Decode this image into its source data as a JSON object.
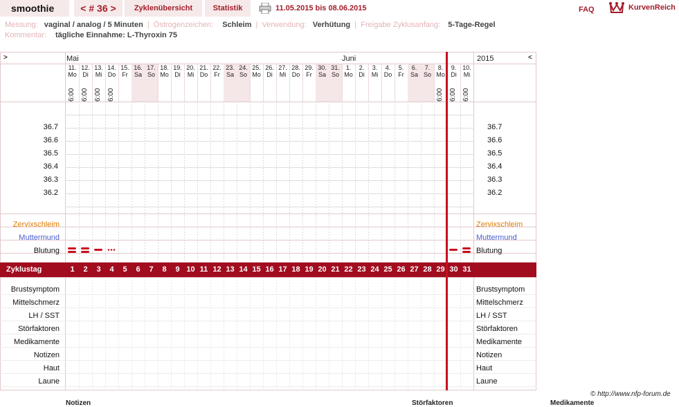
{
  "header": {
    "user": "smoothie",
    "cycle_nav": "< # 36 >",
    "tab_overview": "Zyklenübersicht",
    "tab_stats": "Statistik",
    "date_range": "11.05.2015 bis 08.06.2015",
    "faq": "FAQ",
    "logo_text": "KurvenReich"
  },
  "meta": {
    "messung_k": "Messung:",
    "messung_v": "vaginal / analog / 5 Minuten",
    "oestrogen_k": "Östrogenzeichen:",
    "oestrogen_v": "Schleim",
    "verwendung_k": "Verwendung:",
    "verwendung_v": "Verhütung",
    "freigabe_k": "Freigabe Zyklusanfang:",
    "freigabe_v": "5-Tage-Regel",
    "kommentar_k": "Kommentar:",
    "kommentar_v": "tägliche Einnahme: L-Thyroxin 75"
  },
  "chart": {
    "nav_left": ">",
    "nav_right": "<",
    "month_1": "Mai",
    "month_2": "Juni",
    "year": "2015",
    "days": [
      {
        "d": "11.",
        "w": "Mo",
        "t": "6:00",
        "we": false
      },
      {
        "d": "12.",
        "w": "Di",
        "t": "6:00",
        "we": false
      },
      {
        "d": "13.",
        "w": "Mi",
        "t": "6:00",
        "we": false
      },
      {
        "d": "14.",
        "w": "Do",
        "t": "6:00",
        "we": false
      },
      {
        "d": "15.",
        "w": "Fr",
        "t": "",
        "we": false
      },
      {
        "d": "16.",
        "w": "Sa",
        "t": "",
        "we": true
      },
      {
        "d": "17.",
        "w": "So",
        "t": "",
        "we": true
      },
      {
        "d": "18.",
        "w": "Mo",
        "t": "",
        "we": false
      },
      {
        "d": "19.",
        "w": "Di",
        "t": "",
        "we": false
      },
      {
        "d": "20.",
        "w": "Mi",
        "t": "",
        "we": false
      },
      {
        "d": "21.",
        "w": "Do",
        "t": "",
        "we": false
      },
      {
        "d": "22.",
        "w": "Fr",
        "t": "",
        "we": false
      },
      {
        "d": "23.",
        "w": "Sa",
        "t": "",
        "we": true
      },
      {
        "d": "24.",
        "w": "So",
        "t": "",
        "we": true
      },
      {
        "d": "25.",
        "w": "Mo",
        "t": "",
        "we": false
      },
      {
        "d": "26.",
        "w": "Di",
        "t": "",
        "we": false
      },
      {
        "d": "27.",
        "w": "Mi",
        "t": "",
        "we": false
      },
      {
        "d": "28.",
        "w": "Do",
        "t": "",
        "we": false
      },
      {
        "d": "29.",
        "w": "Fr",
        "t": "",
        "we": false
      },
      {
        "d": "30.",
        "w": "Sa",
        "t": "",
        "we": true
      },
      {
        "d": "31.",
        "w": "So",
        "t": "",
        "we": true
      },
      {
        "d": "1.",
        "w": "Mo",
        "t": "",
        "we": false
      },
      {
        "d": "2.",
        "w": "Di",
        "t": "",
        "we": false
      },
      {
        "d": "3.",
        "w": "Mi",
        "t": "",
        "we": false
      },
      {
        "d": "4.",
        "w": "Do",
        "t": "",
        "we": false
      },
      {
        "d": "5.",
        "w": "Fr",
        "t": "",
        "we": false
      },
      {
        "d": "6.",
        "w": "Sa",
        "t": "",
        "we": true
      },
      {
        "d": "7.",
        "w": "So",
        "t": "",
        "we": true
      },
      {
        "d": "8.",
        "w": "Mo",
        "t": "6:00",
        "we": false
      },
      {
        "d": "9.",
        "w": "Di",
        "t": "6:00",
        "we": false
      },
      {
        "d": "10.",
        "w": "Mi",
        "t": "6:00",
        "we": false
      }
    ],
    "temps": [
      "36.7",
      "36.6",
      "36.5",
      "36.4",
      "36.3",
      "36.2"
    ],
    "row_zervix": "Zervixschleim",
    "row_muttermund": "Muttermund",
    "row_blutung": "Blutung",
    "zyklustag_label": "Zyklustag",
    "zyklustage": [
      "1",
      "2",
      "3",
      "4",
      "5",
      "6",
      "7",
      "8",
      "9",
      "10",
      "11",
      "12",
      "13",
      "14",
      "15",
      "16",
      "17",
      "18",
      "19",
      "20",
      "21",
      "22",
      "23",
      "24",
      "25",
      "26",
      "27",
      "28",
      "29",
      "30",
      "31"
    ],
    "bottom_rows": [
      "Brustsymptom",
      "Mittelschmerz",
      "LH / SST",
      "Störfaktoren",
      "Medikamente",
      "Notizen",
      "Haut",
      "Laune"
    ],
    "bleeding": [
      {
        "day": 1,
        "level": "stark"
      },
      {
        "day": 2,
        "level": "stark"
      },
      {
        "day": 3,
        "level": "mittel"
      },
      {
        "day": 4,
        "level": "schmier"
      },
      {
        "day": 30,
        "level": "mittel"
      },
      {
        "day": 31,
        "level": "stark"
      }
    ],
    "colors": {
      "accent": "#a10c1f",
      "zervix": "#e07b00",
      "muttermund": "#4a5fcf",
      "today": "#c6101f"
    }
  },
  "footer": {
    "copyright": "© http://www.nfp-forum.de",
    "notizen": "Notizen",
    "stoerfaktoren": "Störfaktoren",
    "medikamente": "Medikamente"
  }
}
